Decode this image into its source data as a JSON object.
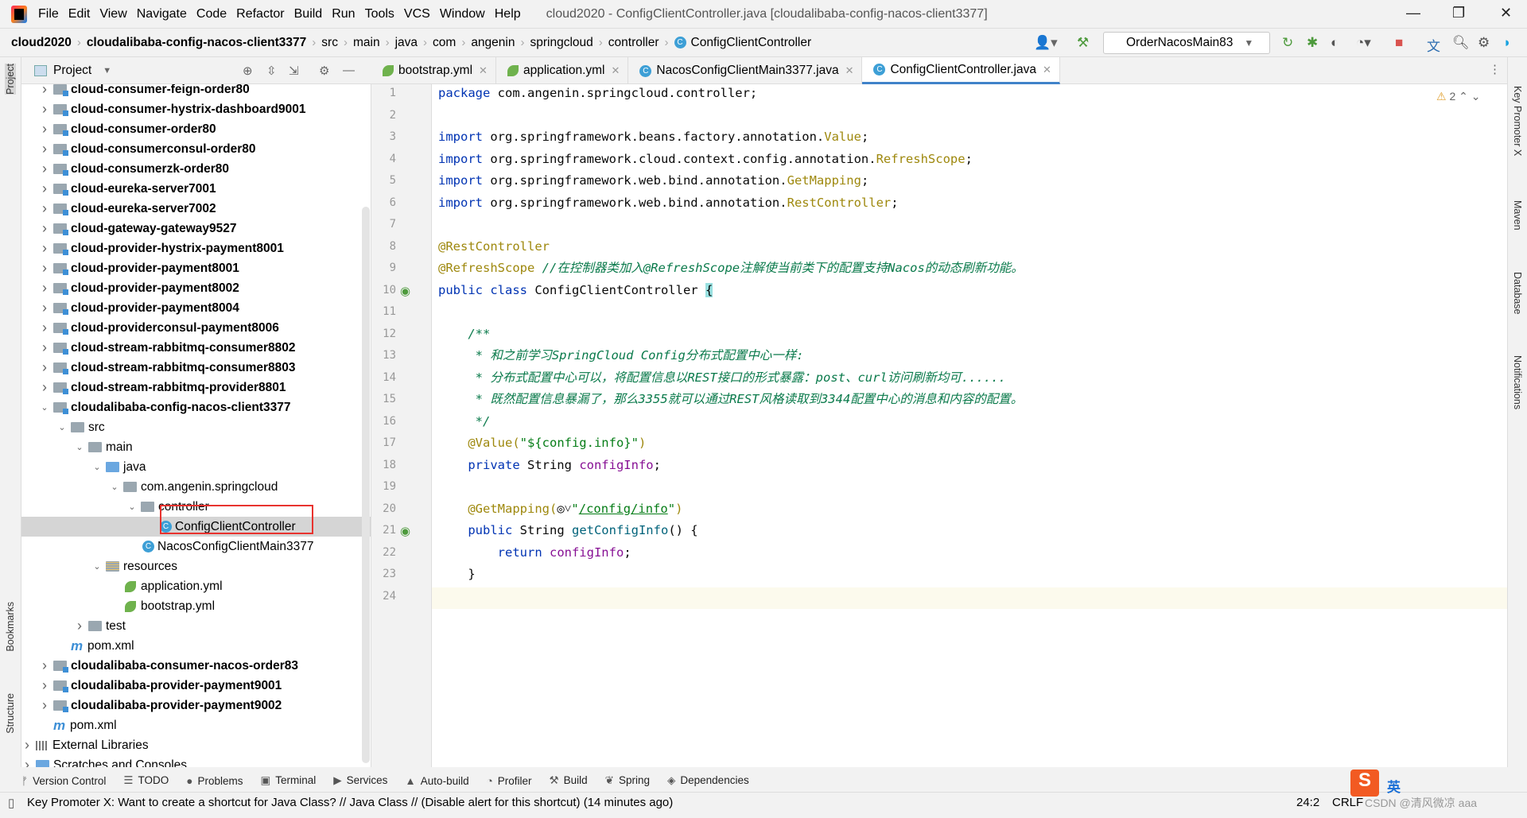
{
  "window": {
    "title": "cloud2020 - ConfigClientController.java [cloudalibaba-config-nacos-client3377]",
    "menu": [
      "File",
      "Edit",
      "View",
      "Navigate",
      "Code",
      "Refactor",
      "Build",
      "Run",
      "Tools",
      "VCS",
      "Window",
      "Help"
    ]
  },
  "breadcrumb": [
    "cloud2020",
    "cloudalibaba-config-nacos-client3377",
    "src",
    "main",
    "java",
    "com",
    "angenin",
    "springcloud",
    "controller",
    "ConfigClientController"
  ],
  "toolbar": {
    "run_config": "OrderNacosMain83"
  },
  "left_strip": {
    "project": "Project",
    "bookmarks": "Bookmarks",
    "structure": "Structure"
  },
  "right_strip": {
    "key_promoter": "Key Promoter X",
    "maven": "Maven",
    "database": "Database",
    "notifications": "Notifications"
  },
  "project_panel": {
    "title": "Project"
  },
  "tree": [
    {
      "t": "cloud-consumer-feign-order80",
      "lvl": 0,
      "ic": "mod",
      "b": true,
      "ar": ">"
    },
    {
      "t": "cloud-consumer-hystrix-dashboard9001",
      "lvl": 0,
      "ic": "mod",
      "b": true,
      "ar": ">"
    },
    {
      "t": "cloud-consumer-order80",
      "lvl": 0,
      "ic": "mod",
      "b": true,
      "ar": ">"
    },
    {
      "t": "cloud-consumerconsul-order80",
      "lvl": 0,
      "ic": "mod",
      "b": true,
      "ar": ">"
    },
    {
      "t": "cloud-consumerzk-order80",
      "lvl": 0,
      "ic": "mod",
      "b": true,
      "ar": ">"
    },
    {
      "t": "cloud-eureka-server7001",
      "lvl": 0,
      "ic": "mod",
      "b": true,
      "ar": ">"
    },
    {
      "t": "cloud-eureka-server7002",
      "lvl": 0,
      "ic": "mod",
      "b": true,
      "ar": ">"
    },
    {
      "t": "cloud-gateway-gateway9527",
      "lvl": 0,
      "ic": "mod",
      "b": true,
      "ar": ">"
    },
    {
      "t": "cloud-provider-hystrix-payment8001",
      "lvl": 0,
      "ic": "mod",
      "b": true,
      "ar": ">"
    },
    {
      "t": "cloud-provider-payment8001",
      "lvl": 0,
      "ic": "mod",
      "b": true,
      "ar": ">"
    },
    {
      "t": "cloud-provider-payment8002",
      "lvl": 0,
      "ic": "mod",
      "b": true,
      "ar": ">"
    },
    {
      "t": "cloud-provider-payment8004",
      "lvl": 0,
      "ic": "mod",
      "b": true,
      "ar": ">"
    },
    {
      "t": "cloud-providerconsul-payment8006",
      "lvl": 0,
      "ic": "mod",
      "b": true,
      "ar": ">"
    },
    {
      "t": "cloud-stream-rabbitmq-consumer8802",
      "lvl": 0,
      "ic": "mod",
      "b": true,
      "ar": ">"
    },
    {
      "t": "cloud-stream-rabbitmq-consumer8803",
      "lvl": 0,
      "ic": "mod",
      "b": true,
      "ar": ">"
    },
    {
      "t": "cloud-stream-rabbitmq-provider8801",
      "lvl": 0,
      "ic": "mod",
      "b": true,
      "ar": ">"
    },
    {
      "t": "cloudalibaba-config-nacos-client3377",
      "lvl": 0,
      "ic": "mod",
      "b": true,
      "ar": "v"
    },
    {
      "t": "src",
      "lvl": 1,
      "ic": "folder",
      "ar": "v"
    },
    {
      "t": "main",
      "lvl": 2,
      "ic": "folder",
      "ar": "v"
    },
    {
      "t": "java",
      "lvl": 3,
      "ic": "src",
      "ar": "v"
    },
    {
      "t": "com.angenin.springcloud",
      "lvl": 4,
      "ic": "folder",
      "ar": "v"
    },
    {
      "t": "controller",
      "lvl": 5,
      "ic": "folder",
      "ar": "v"
    },
    {
      "t": "ConfigClientController",
      "lvl": 6,
      "ic": "class",
      "ar": "",
      "sel": true
    },
    {
      "t": "NacosConfigClientMain3377",
      "lvl": 5,
      "ic": "class",
      "ar": ""
    },
    {
      "t": "resources",
      "lvl": 3,
      "ic": "res",
      "ar": "v"
    },
    {
      "t": "application.yml",
      "lvl": 4,
      "ic": "yml",
      "ar": ""
    },
    {
      "t": "bootstrap.yml",
      "lvl": 4,
      "ic": "yml",
      "ar": ""
    },
    {
      "t": "test",
      "lvl": 2,
      "ic": "folder",
      "ar": ">"
    },
    {
      "t": "pom.xml",
      "lvl": 1,
      "ic": "maven",
      "ar": ""
    },
    {
      "t": "cloudalibaba-consumer-nacos-order83",
      "lvl": 0,
      "ic": "mod",
      "b": true,
      "ar": ">"
    },
    {
      "t": "cloudalibaba-provider-payment9001",
      "lvl": 0,
      "ic": "mod",
      "b": true,
      "ar": ">"
    },
    {
      "t": "cloudalibaba-provider-payment9002",
      "lvl": 0,
      "ic": "mod",
      "b": true,
      "ar": ">"
    },
    {
      "t": "pom.xml",
      "lvl": 0,
      "ic": "maven",
      "ar": ""
    },
    {
      "t": "External Libraries",
      "lvl": -1,
      "ic": "lib",
      "ar": ">"
    },
    {
      "t": "Scratches and Consoles",
      "lvl": -1,
      "ic": "scratch",
      "ar": ">"
    }
  ],
  "tabs": [
    {
      "label": "bootstrap.yml"
    },
    {
      "label": "application.yml"
    },
    {
      "label": "NacosConfigClientMain3377.java"
    },
    {
      "label": "ConfigClientController.java",
      "active": true
    }
  ],
  "editor": {
    "warnings": "2",
    "cursor_line": 24,
    "lines": [
      [
        [
          "package ",
          "kw"
        ],
        [
          "com.angenin.springcloud.controller;",
          "plain"
        ]
      ],
      [],
      [
        [
          "import ",
          "kw"
        ],
        [
          "org.springframework.beans.factory.annotation.",
          "plain"
        ],
        [
          "Value",
          "an"
        ],
        [
          ";",
          "plain"
        ]
      ],
      [
        [
          "import ",
          "kw"
        ],
        [
          "org.springframework.cloud.context.config.annotation.",
          "plain"
        ],
        [
          "RefreshScope",
          "an"
        ],
        [
          ";",
          "plain"
        ]
      ],
      [
        [
          "import ",
          "kw"
        ],
        [
          "org.springframework.web.bind.annotation.",
          "plain"
        ],
        [
          "GetMapping",
          "an"
        ],
        [
          ";",
          "plain"
        ]
      ],
      [
        [
          "import ",
          "kw"
        ],
        [
          "org.springframework.web.bind.annotation.",
          "plain"
        ],
        [
          "RestController",
          "an"
        ],
        [
          ";",
          "plain"
        ]
      ],
      [],
      [
        [
          "@RestController",
          "an"
        ]
      ],
      [
        [
          "@RefreshScope",
          "an"
        ],
        [
          " //在控制器类加入@RefreshScope注解使当前类下的配置支持Nacos的动态刷新功能。",
          "cm"
        ]
      ],
      [
        [
          "public class ",
          "kw"
        ],
        [
          "ConfigClientController ",
          "plain"
        ],
        [
          "{",
          "br"
        ]
      ],
      [],
      [
        [
          "    /**",
          "cm"
        ]
      ],
      [
        [
          "     * 和之前学习SpringCloud Config分布式配置中心一样:",
          "cm"
        ]
      ],
      [
        [
          "     * 分布式配置中心可以，将配置信息以REST接口的形式暴露：post、curl访问刷新均可......",
          "cm"
        ]
      ],
      [
        [
          "     * 既然配置信息暴漏了，那么3355就可以通过REST风格读取到3344配置中心的消息和内容的配置。",
          "cm"
        ]
      ],
      [
        [
          "     */",
          "cm"
        ]
      ],
      [
        [
          "    @Value(",
          "an"
        ],
        [
          "\"${config.info}\"",
          "st"
        ],
        [
          ")",
          "an"
        ]
      ],
      [
        [
          "    private ",
          "kw"
        ],
        [
          "String ",
          "plain"
        ],
        [
          "configInfo",
          "fd"
        ],
        [
          ";",
          "plain"
        ]
      ],
      [],
      [
        [
          "    @GetMapping(",
          "an"
        ],
        [
          "◎˅",
          "plain"
        ],
        [
          "\"",
          "st"
        ],
        [
          "/config/info",
          "url"
        ],
        [
          "\"",
          "st"
        ],
        [
          ")",
          "an"
        ]
      ],
      [
        [
          "    public ",
          "kw"
        ],
        [
          "String ",
          "plain"
        ],
        [
          "getConfigInfo",
          "fn"
        ],
        [
          "() {",
          "plain"
        ]
      ],
      [
        [
          "        return ",
          "kw"
        ],
        [
          "configInfo",
          "fd"
        ],
        [
          ";",
          "plain"
        ]
      ],
      [
        [
          "    }",
          "plain"
        ]
      ],
      [
        [
          "}",
          "br"
        ]
      ]
    ]
  },
  "bottom_tools": [
    {
      "icon": "ᚠ",
      "label": "Version Control"
    },
    {
      "icon": "☰",
      "label": "TODO"
    },
    {
      "icon": "●",
      "label": "Problems"
    },
    {
      "icon": "▣",
      "label": "Terminal"
    },
    {
      "icon": "▶",
      "label": "Services"
    },
    {
      "icon": "▲",
      "label": "Auto-build"
    },
    {
      "icon": "◔",
      "label": "Profiler"
    },
    {
      "icon": "⚒",
      "label": "Build"
    },
    {
      "icon": "❦",
      "label": "Spring"
    },
    {
      "icon": "◈",
      "label": "Dependencies"
    }
  ],
  "status": {
    "message": "Key Promoter X: Want to create a shortcut for Java Class? // Java Class // (Disable alert for this shortcut) (14 minutes ago)",
    "position": "24:2",
    "line_sep": "CRLF",
    "watermark": "CSDN @清风微凉 aaa",
    "ime": "英"
  }
}
